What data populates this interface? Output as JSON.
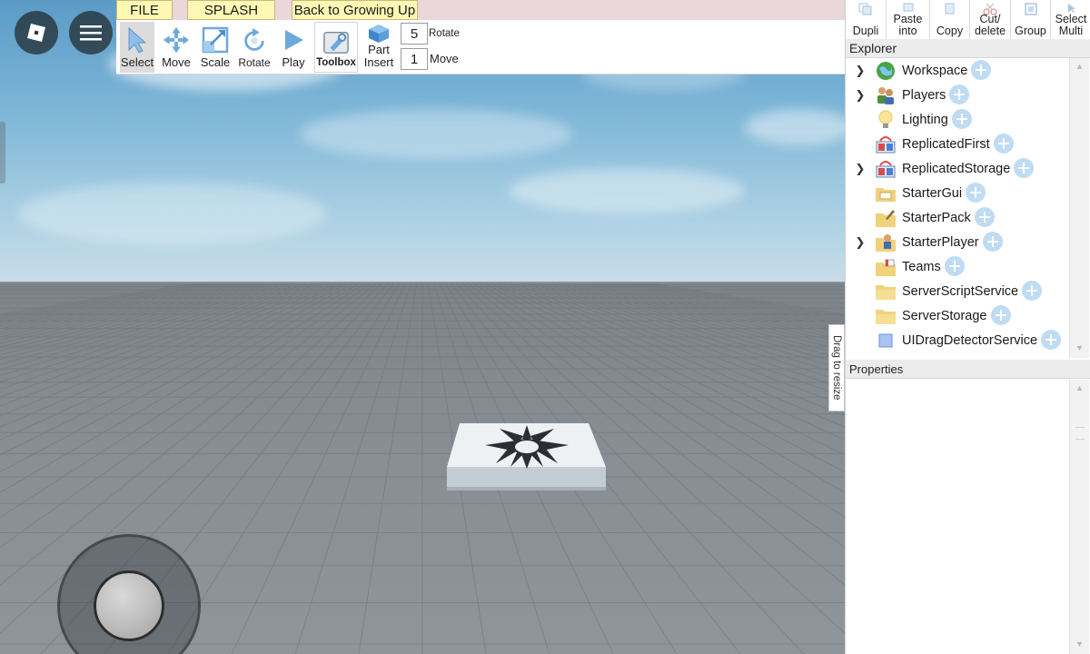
{
  "menu": {
    "file": "FILE",
    "splash": "SPLASH",
    "back": "Back to Growing Up"
  },
  "toolbar": {
    "select": "Select",
    "move": "Move",
    "scale": "Scale",
    "rotate": "Rotate",
    "play": "Play",
    "toolbox": "Toolbox",
    "part_line1": "Part",
    "part_line2": "Insert",
    "rotate_step_value": "5",
    "rotate_step_label": "Rotate",
    "move_step_value": "1",
    "move_step_label": "Move"
  },
  "panel_toolbar": {
    "dupli": "Dupli",
    "paste_into_1": "Paste",
    "paste_into_2": "into",
    "copy": "Copy",
    "cut_delete_1": "Cut/",
    "cut_delete_2": "delete",
    "group": "Group",
    "select_multi_1": "Select",
    "select_multi_2": "Multi"
  },
  "explorer": {
    "title": "Explorer",
    "items": [
      {
        "label": "Workspace",
        "expandable": true,
        "icon": "workspace-icon"
      },
      {
        "label": "Players",
        "expandable": true,
        "icon": "players-icon"
      },
      {
        "label": "Lighting",
        "expandable": false,
        "icon": "lighting-icon"
      },
      {
        "label": "ReplicatedFirst",
        "expandable": false,
        "icon": "replicated-first-icon"
      },
      {
        "label": "ReplicatedStorage",
        "expandable": true,
        "icon": "replicated-storage-icon"
      },
      {
        "label": "StarterGui",
        "expandable": false,
        "icon": "starter-gui-icon"
      },
      {
        "label": "StarterPack",
        "expandable": false,
        "icon": "starter-pack-icon"
      },
      {
        "label": "StarterPlayer",
        "expandable": true,
        "icon": "starter-player-icon"
      },
      {
        "label": "Teams",
        "expandable": false,
        "icon": "teams-icon"
      },
      {
        "label": "ServerScriptService",
        "expandable": false,
        "icon": "server-script-service-icon"
      },
      {
        "label": "ServerStorage",
        "expandable": false,
        "icon": "server-storage-icon"
      },
      {
        "label": "UIDragDetectorService",
        "expandable": false,
        "icon": "ui-drag-detector-icon"
      }
    ]
  },
  "properties": {
    "title": "Properties"
  },
  "resize_handle": "Drag to resize",
  "colors": {
    "menu_tab": "#fff8b5",
    "menu_strip": "#ead7da",
    "plus_badge": "#bfdcf3",
    "selected_tool": "#dcdcdc"
  }
}
